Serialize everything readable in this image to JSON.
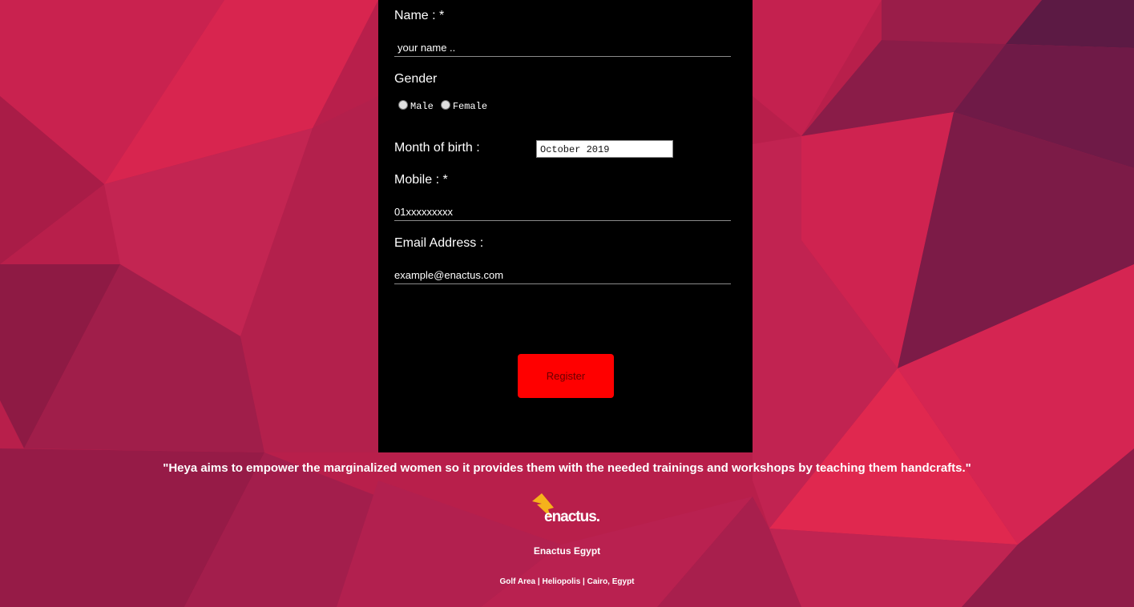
{
  "form": {
    "name_label": "Name : *",
    "name_placeholder": "your name ..",
    "gender_label": "Gender",
    "gender_options": [
      "Male",
      "Female"
    ],
    "month_label": "Month of birth :",
    "month_value": "October 2019",
    "mobile_label": "Mobile : *",
    "mobile_placeholder": "01xxxxxxxxx",
    "email_label": "Email Address :",
    "email_placeholder": "example@enactus.com",
    "register_label": "Register"
  },
  "footer": {
    "quote": "\"Heya aims to empower the marginalized women so it provides them with the needed trainings and workshops by teaching them handcrafts.\"",
    "logo_text": "enactus.",
    "org_name": "Enactus Egypt",
    "address": "Golf Area | Heliopolis | Cairo, Egypt"
  },
  "colors": {
    "background": "#b81f4b",
    "panel": "#000000",
    "button": "#ff0000",
    "logo_accent": "#f5b21b"
  },
  "icons": {
    "logo_mark": "enactus-chevron-icon"
  }
}
